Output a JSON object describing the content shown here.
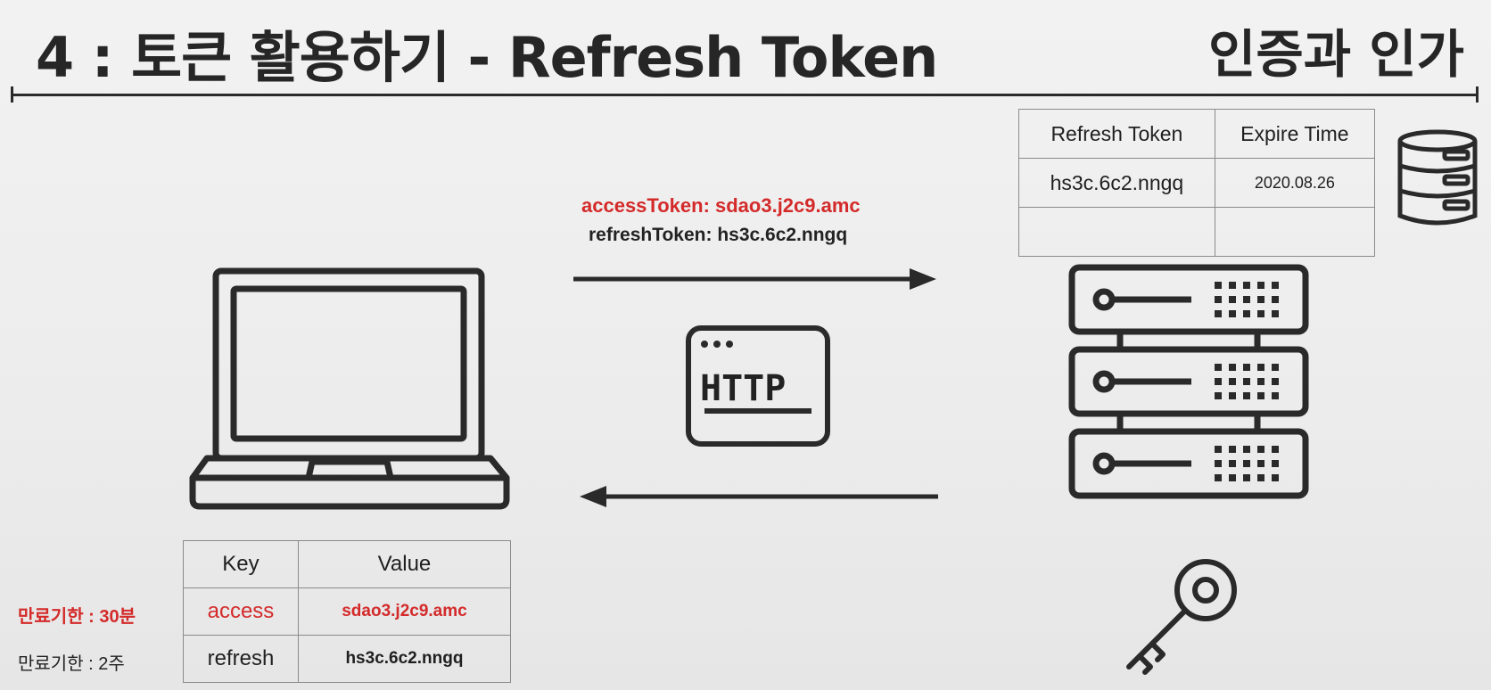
{
  "header": {
    "title": "4 : 토큰 활용하기 - Refresh Token",
    "subtitle": "인증과 인가"
  },
  "server_db_table": {
    "headers": [
      "Refresh Token",
      "Expire Time"
    ],
    "rows": [
      [
        "hs3c.6c2.nngq",
        "2020.08.26"
      ],
      [
        "",
        ""
      ]
    ]
  },
  "request": {
    "access_token_line": "accessToken: sdao3.j2c9.amc",
    "refresh_token_line": "refreshToken: hs3c.6c2.nngq"
  },
  "http_badge": {
    "label": "HTTP"
  },
  "client_storage": {
    "headers": [
      "Key",
      "Value"
    ],
    "rows": [
      {
        "key": "access",
        "value": "sdao3.j2c9.amc",
        "expiry": "만료기한 : 30분"
      },
      {
        "key": "refresh",
        "value": "hs3c.6c2.nngq",
        "expiry": "만료기한 : 2주"
      }
    ]
  },
  "icons": [
    "laptop-icon",
    "server-icon",
    "database-icon",
    "key-icon",
    "http-icon",
    "arrow-right-icon",
    "arrow-left-icon"
  ],
  "colors": {
    "accent_red": "#d42a2a",
    "line": "#2a2a2a"
  }
}
